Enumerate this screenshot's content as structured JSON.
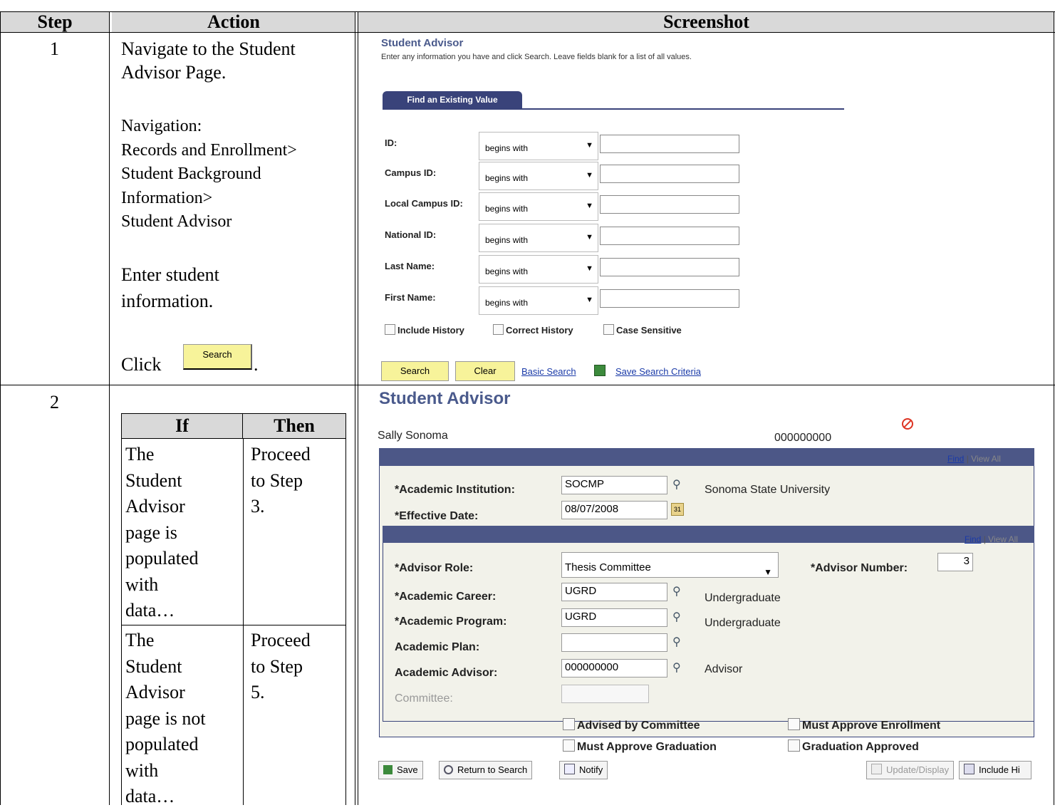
{
  "headers": {
    "step": "Step",
    "action": "Action",
    "screenshot": "Screenshot"
  },
  "row1": {
    "step": "1",
    "action": {
      "line1": "Navigate to the Student",
      "line2": "Advisor Page.",
      "nav_label": "Navigation:",
      "nav1": "Records and Enrollment>",
      "nav2": "Student Background",
      "nav3": "Information>",
      "nav4": "Student Advisor",
      "enter1": "Enter student",
      "enter2": "information.",
      "click": "Click",
      "click_btn": "Search",
      "period": "."
    },
    "shot": {
      "title": "Student Advisor",
      "instructions": "Enter any information you have and click Search. Leave fields blank for a list of all values.",
      "tab": "Find an Existing Value",
      "fields": [
        {
          "label": "ID:",
          "operator": "begins with",
          "value": ""
        },
        {
          "label": "Campus ID:",
          "operator": "begins with",
          "value": ""
        },
        {
          "label": "Local Campus ID:",
          "operator": "begins with",
          "value": ""
        },
        {
          "label": "National ID:",
          "operator": "begins with",
          "value": ""
        },
        {
          "label": "Last Name:",
          "operator": "begins with",
          "value": ""
        },
        {
          "label": "First Name:",
          "operator": "begins with",
          "value": ""
        }
      ],
      "checkboxes": [
        "Include History",
        "Correct History",
        "Case Sensitive"
      ],
      "search_btn": "Search",
      "clear_btn": "Clear",
      "basic_search": "Basic Search",
      "save_criteria": "Save Search Criteria"
    }
  },
  "row2": {
    "step": "2",
    "inner_table": {
      "if_header": "If",
      "then_header": "Then",
      "rows": [
        {
          "if": [
            "The",
            "Student",
            "Advisor",
            "page is",
            "populated",
            "with",
            "data…"
          ],
          "then": [
            "Proceed",
            "to Step",
            "3."
          ]
        },
        {
          "if": [
            "The",
            "Student",
            "Advisor",
            "page is not",
            "populated",
            "with",
            "data…"
          ],
          "then": [
            "Proceed",
            "to Step",
            "5."
          ]
        }
      ]
    },
    "shot": {
      "title": "Student Advisor",
      "name": "Sally Sonoma",
      "emplid": "000000000",
      "find": "Find",
      "view_all": "View All",
      "inst_label": "*Academic Institution:",
      "inst_value": "SOCMP",
      "inst_desc": "Sonoma State University",
      "eff_label": "*Effective Date:",
      "eff_value": "08/07/2008",
      "role_label": "*Advisor Role:",
      "role_value": "Thesis Committee",
      "num_label": "*Advisor Number:",
      "num_value": "3",
      "career_label": "*Academic Career:",
      "career_value": "UGRD",
      "career_desc": "Undergraduate",
      "program_label": "*Academic Program:",
      "program_value": "UGRD",
      "program_desc": "Undergraduate",
      "plan_label": "Academic Plan:",
      "plan_value": "",
      "advisor_label": "Academic Advisor:",
      "advisor_value": "000000000",
      "advisor_desc": "Advisor",
      "committee_label": "Committee:",
      "cb_advised": "Advised by Committee",
      "cb_must_enroll": "Must Approve Enrollment",
      "cb_must_grad": "Must Approve Graduation",
      "cb_grad_approved": "Graduation Approved",
      "btn_save": "Save",
      "btn_return": "Return to Search",
      "btn_notify": "Notify",
      "btn_update": "Update/Display",
      "btn_include": "Include Hi"
    }
  }
}
